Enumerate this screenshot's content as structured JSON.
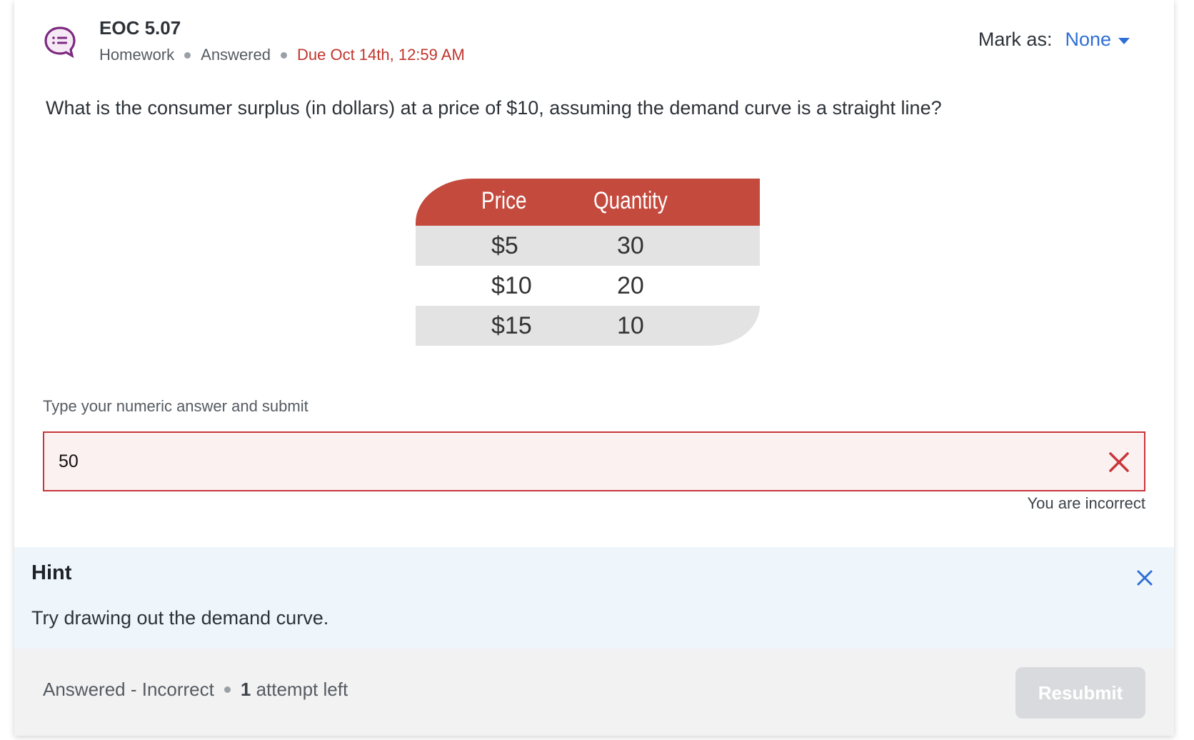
{
  "header": {
    "icon": "question-list-icon",
    "title": "EOC 5.07",
    "type": "Homework",
    "state": "Answered",
    "due": "Due Oct 14th, 12:59 AM",
    "mark_as_label": "Mark as:",
    "mark_as_value": "None"
  },
  "question": {
    "text": "What is the consumer surplus (in dollars) at a price of $10, assuming the demand curve is a straight line?"
  },
  "table": {
    "headers": [
      "Price",
      "Quantity"
    ],
    "rows": [
      [
        "$5",
        "30"
      ],
      [
        "$10",
        "20"
      ],
      [
        "$15",
        "10"
      ]
    ],
    "header_color": "#c44a3e",
    "stripe_color": "#e3e3e3"
  },
  "answer": {
    "label": "Type your numeric answer and submit",
    "value": "50",
    "feedback": "You are incorrect",
    "error_color": "#c8363a"
  },
  "hint": {
    "title": "Hint",
    "text": "Try drawing out the demand curve."
  },
  "footer": {
    "status": "Answered - Incorrect",
    "attempts_count": "1",
    "attempts_suffix": " attempt left",
    "resubmit_label": "Resubmit"
  }
}
